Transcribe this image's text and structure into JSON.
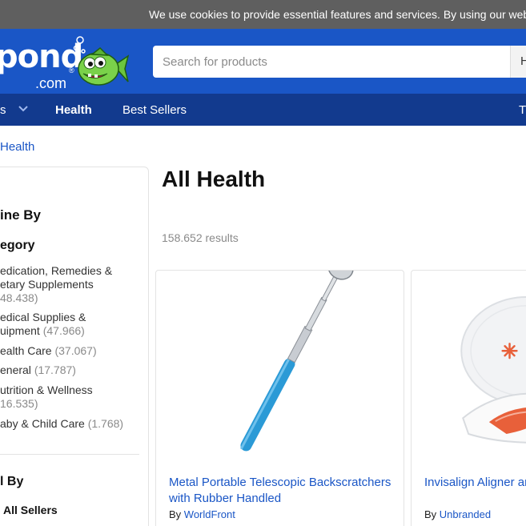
{
  "cookie_banner": {
    "text": "We use cookies to provide essential features and services. By using our website"
  },
  "header": {
    "logo_main": "pond",
    "logo_domain": ".com",
    "logo_reg": "®",
    "search_placeholder": "Search for products",
    "search_button_label": "H"
  },
  "nav": {
    "items": [
      {
        "label": "s"
      },
      {
        "label": "Health"
      },
      {
        "label": "Best Sellers"
      },
      {
        "label": "Tr"
      }
    ]
  },
  "breadcrumb": {
    "current": "Health"
  },
  "sidebar": {
    "refine_title": "ine By",
    "category_title": "egory",
    "categories": [
      {
        "line1": "edication, Remedies &",
        "line2": "etary Supplements",
        "count": "48.438)"
      },
      {
        "line1": "edical Supplies &",
        "line2": "uipment",
        "count": "(47.966)"
      },
      {
        "label": "ealth Care",
        "count": "(37.067)"
      },
      {
        "label": "eneral",
        "count": "(17.787)"
      },
      {
        "label": "utrition & Wellness",
        "count": "16.535)"
      },
      {
        "label": "aby & Child Care",
        "count": "(1.768)"
      }
    ],
    "sold_by_title": "l By",
    "all_sellers": "All Sellers"
  },
  "main": {
    "title": "All Health",
    "results_text": "158.652 results",
    "products": [
      {
        "title": "Metal Portable Telescopic Backscratchers with Rubber Handled",
        "by": "By",
        "brand": "WorldFront"
      },
      {
        "title": "Invisalign Aligner ar (White)",
        "by": "By",
        "brand": "Unbranded"
      }
    ]
  },
  "colors": {
    "brand_blue": "#1a56c6",
    "nav_blue": "#123a8e",
    "cookie_gray": "#5f5f5f",
    "scratcher_handle": "#2b9ad6",
    "case_accent": "#e8603a"
  }
}
